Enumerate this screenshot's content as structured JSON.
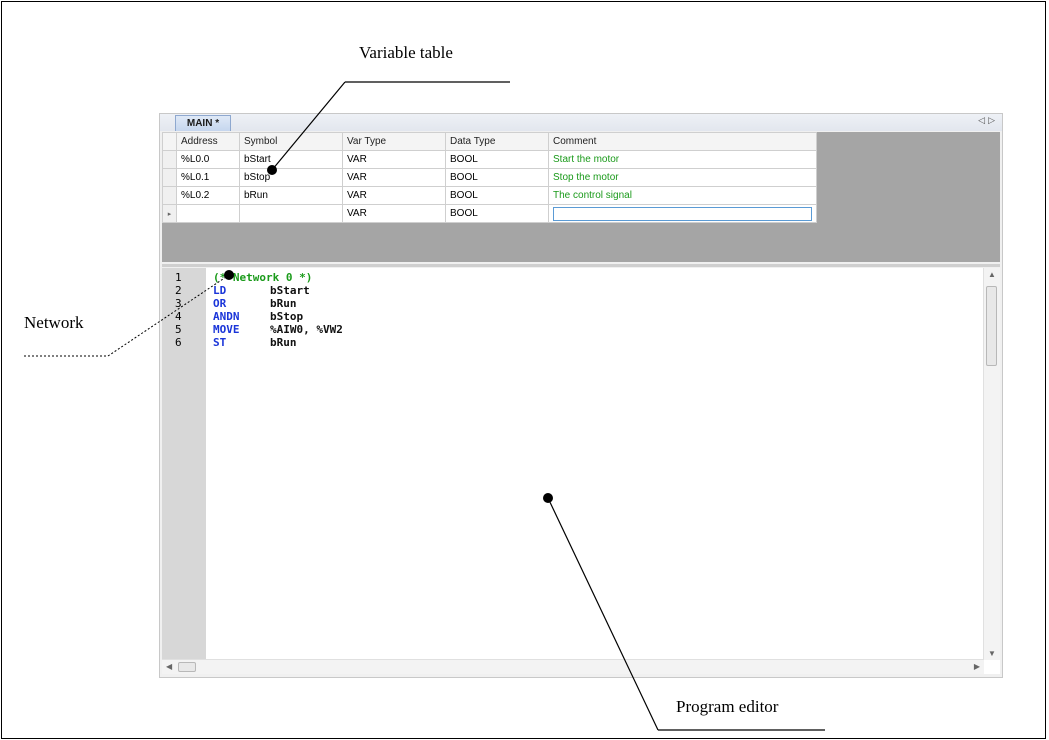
{
  "callouts": {
    "variable_table": "Variable table",
    "network": "Network",
    "program_editor": "Program editor"
  },
  "tab": {
    "label": "MAIN *"
  },
  "tab_nav": {
    "left": "◁",
    "right": "▷"
  },
  "variable_table": {
    "headers": [
      "Address",
      "Symbol",
      "Var Type",
      "Data Type",
      "Comment"
    ],
    "rows": [
      {
        "address": "%L0.0",
        "symbol": "bStart",
        "var_type": "VAR",
        "data_type": "BOOL",
        "comment": "Start the motor"
      },
      {
        "address": "%L0.1",
        "symbol": "bStop",
        "var_type": "VAR",
        "data_type": "BOOL",
        "comment": "Stop the motor"
      },
      {
        "address": "%L0.2",
        "symbol": "bRun",
        "var_type": "VAR",
        "data_type": "BOOL",
        "comment": "The control signal"
      }
    ],
    "new_row": {
      "var_type": "VAR",
      "data_type": "BOOL",
      "comment": ""
    },
    "new_row_marker": "▸"
  },
  "editor": {
    "line_numbers": [
      "1",
      "2",
      "3",
      "4",
      "5",
      "6"
    ],
    "lines": [
      {
        "op": "(* Network 0 *)",
        "arg": ""
      },
      {
        "op": "LD",
        "arg": "bStart"
      },
      {
        "op": "OR",
        "arg": "bRun"
      },
      {
        "op": "ANDN",
        "arg": "bStop"
      },
      {
        "op": "MOVE",
        "arg": "%AIW0, %VW2"
      },
      {
        "op": "ST",
        "arg": "bRun"
      }
    ]
  },
  "colors": {
    "keyword": "#1a35d9",
    "comment": "#1b9b1b",
    "panel_bg": "#a5a5a5",
    "gutter_bg": "#d7d7d7"
  }
}
